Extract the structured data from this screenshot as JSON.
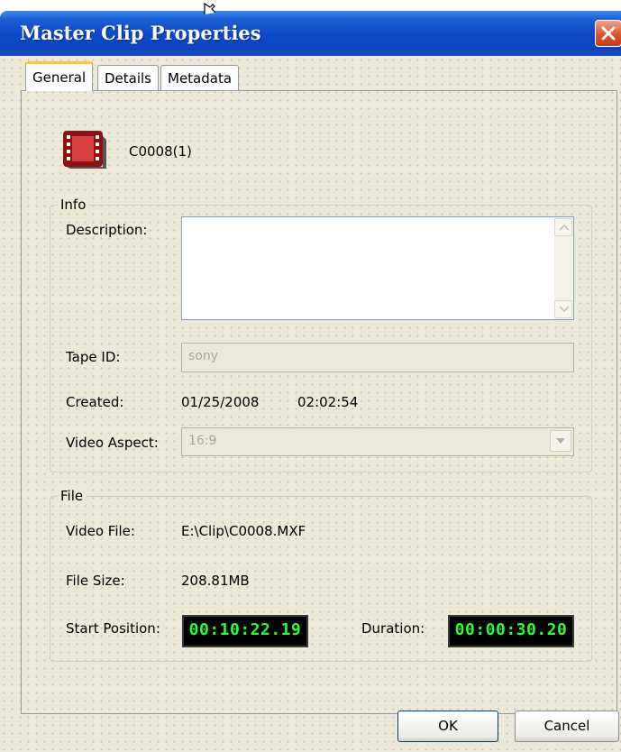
{
  "window": {
    "title": "Master Clip Properties"
  },
  "tabs": [
    "General",
    "Details",
    "Metadata"
  ],
  "clip": {
    "name": "C0008(1)"
  },
  "info": {
    "group_label": "Info",
    "description_label": "Description:",
    "description_value": "",
    "tape_id_label": "Tape ID:",
    "tape_id_value": "sony",
    "created_label": "Created:",
    "created_date": "01/25/2008",
    "created_time": "02:02:54",
    "video_aspect_label": "Video Aspect:",
    "video_aspect_value": "16:9"
  },
  "file": {
    "group_label": "File",
    "video_file_label": "Video File:",
    "video_file_value": "E:\\Clip\\C0008.MXF",
    "file_size_label": "File Size:",
    "file_size_value": "208.81MB",
    "start_position_label": "Start Position:",
    "start_position_value": "00:10:22.19",
    "duration_label": "Duration:",
    "duration_value": "00:00:30.20"
  },
  "buttons": {
    "ok": "OK",
    "cancel": "Cancel"
  },
  "colors": {
    "titlebar": "#0a48c8",
    "lcd_text": "#22ff33",
    "dialog_bg": "#ece9d8",
    "active_tab_accent": "#ffc83c"
  },
  "icons": [
    "film-clip-icon",
    "close-icon",
    "mouse-cursor-icon",
    "scroll-up-icon",
    "scroll-down-icon",
    "dropdown-arrow-icon"
  ]
}
